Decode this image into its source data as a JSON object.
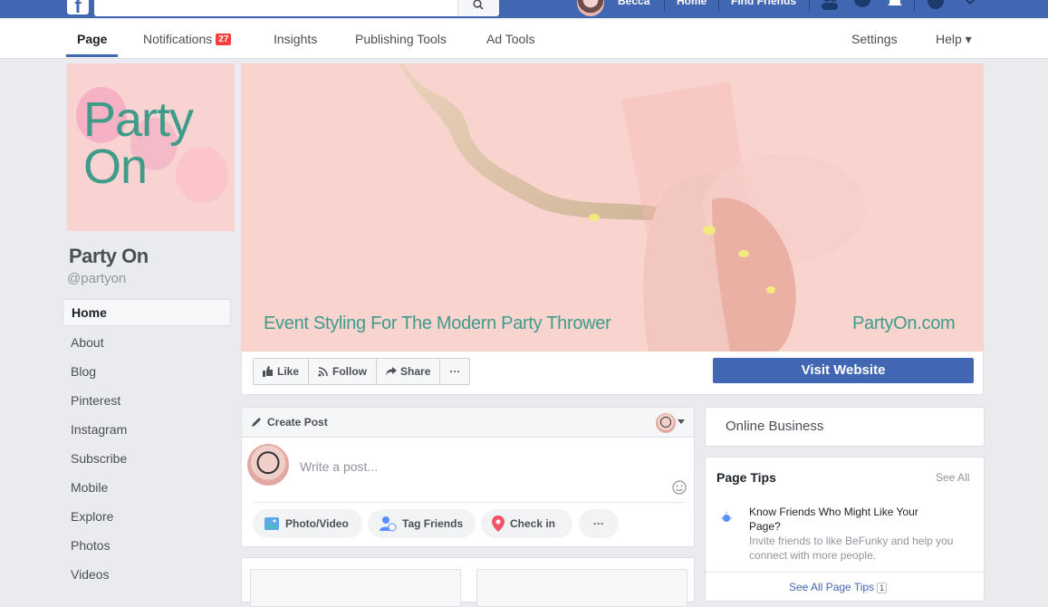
{
  "topbar": {
    "user_name": "Becca",
    "home_label": "Home",
    "find_friends_label": "Find Friends"
  },
  "page_nav": {
    "page_label": "Page",
    "notifications_label": "Notifications",
    "notifications_count": "27",
    "insights_label": "Insights",
    "publishing_tools_label": "Publishing Tools",
    "ad_tools_label": "Ad Tools",
    "settings_label": "Settings",
    "help_label": "Help ▾"
  },
  "profile": {
    "logo_line1": "Party",
    "logo_line2": "On",
    "name": "Party On",
    "handle": "@partyon"
  },
  "sidebar": {
    "items": [
      {
        "label": "Home"
      },
      {
        "label": "About"
      },
      {
        "label": "Blog"
      },
      {
        "label": "Pinterest"
      },
      {
        "label": "Instagram"
      },
      {
        "label": "Subscribe"
      },
      {
        "label": "Mobile"
      },
      {
        "label": "Explore"
      },
      {
        "label": "Photos"
      },
      {
        "label": "Videos"
      }
    ]
  },
  "cover": {
    "tagline": "Event Styling For The Modern Party Thrower",
    "url": "PartyOn.com"
  },
  "actions": {
    "like_label": "Like",
    "follow_label": "Follow",
    "share_label": "Share",
    "more_label": "···",
    "visit_label": "Visit Website"
  },
  "create_post": {
    "title": "Create Post",
    "placeholder": "Write a post...",
    "photo_video_label": "Photo/Video",
    "tag_friends_label": "Tag Friends",
    "check_in_label": "Check in",
    "more_label": "···"
  },
  "right_column": {
    "category": "Online Business",
    "page_tips_title": "Page Tips",
    "see_all_label": "See All",
    "tip_question": "Know Friends Who Might Like Your Page?",
    "tip_description": "Invite friends to like BeFunky and help you connect with more people.",
    "see_all_tips_label": "See All Page Tips",
    "tips_count": "1"
  },
  "colors": {
    "brand_blue": "#4267b2",
    "badge_red": "#fa3e3e",
    "teal_text": "#3f9b8a",
    "cover_pink": "#f9d3ce"
  }
}
